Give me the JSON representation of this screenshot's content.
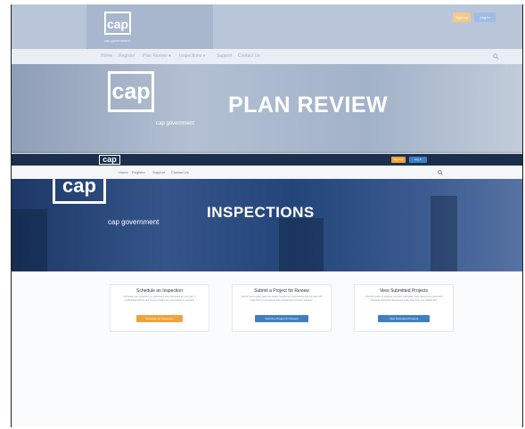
{
  "plan_review": {
    "logo": "cap",
    "logo_sub": "cap government",
    "buttons": {
      "sign_up": "Sign Up",
      "log_in": "Log In"
    },
    "nav": [
      "Home",
      "Register",
      "Plan Review ▾",
      "Inspections ▾",
      "Support",
      "Contact Us"
    ],
    "search_icon": "search-icon",
    "hero_logo": "cap",
    "hero_sub": "cap government",
    "hero_title": "PLAN REVIEW"
  },
  "inspections": {
    "logo": "cap",
    "buttons": {
      "sign_up": "Sign Up",
      "log_in": "Log In"
    },
    "nav": [
      "Home",
      "Register",
      "Support",
      "Contact Us"
    ],
    "search_icon": "search-icon",
    "hero_logo": "cap",
    "hero_sub": "cap government",
    "hero_title": "INSPECTIONS",
    "cards": [
      {
        "title": "Schedule an Inspection",
        "text": "Schedule your inspection by selecting a time that works for your site. A confirmation will be sent to your email once your request is received.",
        "button": "Schedule an Inspection",
        "button_color": "#f0a23c"
      },
      {
        "title": "Submit a Project for Review",
        "text": "Submit your project plans for review. Upload your documents and our team will route them to the appropriate reviewers for a timely response.",
        "button": "Submit a Project for Review",
        "button_color": "#3f7fc4"
      },
      {
        "title": "View Submitted Projects",
        "text": "View the status of projects you have submitted, track review comments and download approved documents at any time from your dashboard.",
        "button": "View Submitted Projects",
        "button_color": "#3f7fc4"
      }
    ]
  },
  "colors": {
    "nav_dark": "#1c2f4d",
    "accent_orange": "#f0a23c",
    "accent_blue": "#3f7fc4",
    "faded_bg": "#c9d3e2"
  }
}
